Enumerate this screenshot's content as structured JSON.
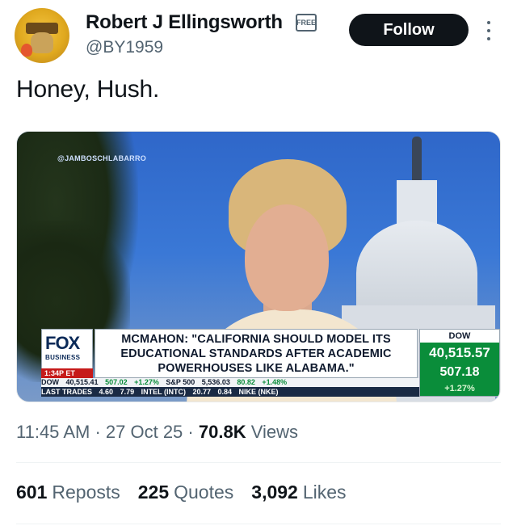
{
  "author": {
    "name": "Robert J Ellingsworth",
    "badge": "FREE",
    "handle": "@BY1959"
  },
  "follow_label": "Follow",
  "tweet_text": "Honey, Hush.",
  "media": {
    "watermark": "@JAMBOSCHLABARRO",
    "network": "FOX",
    "network_sub": "BUSINESS",
    "time": "1:34P ET",
    "headline": "MCMAHON: \"CALIFORNIA SHOULD MODEL ITS EDUCATIONAL STANDARDS AFTER ACADEMIC POWERHOUSES LIKE ALABAMA.\"",
    "dow_label": "DOW",
    "dow_value": "40,515.57",
    "dow_change": "507.18",
    "dow_pct": "+1.27%",
    "ticker_row1": [
      "DOW",
      "40,515.41",
      "507.02",
      "+1.27%",
      "S&P 500",
      "5,536.03",
      "80.82",
      "+1.48%"
    ],
    "ticker_row2": [
      "LAST TRADES",
      "4.60",
      "7.79",
      "INTEL (INTC)",
      "20.77",
      "0.84",
      "NIKE (NKE)"
    ]
  },
  "meta": {
    "time": "11:45 AM",
    "date": "27 Oct 25",
    "views_count": "70.8K",
    "views_label": "Views"
  },
  "stats": {
    "reposts_count": "601",
    "reposts_label": "Reposts",
    "quotes_count": "225",
    "quotes_label": "Quotes",
    "likes_count": "3,092",
    "likes_label": "Likes"
  }
}
